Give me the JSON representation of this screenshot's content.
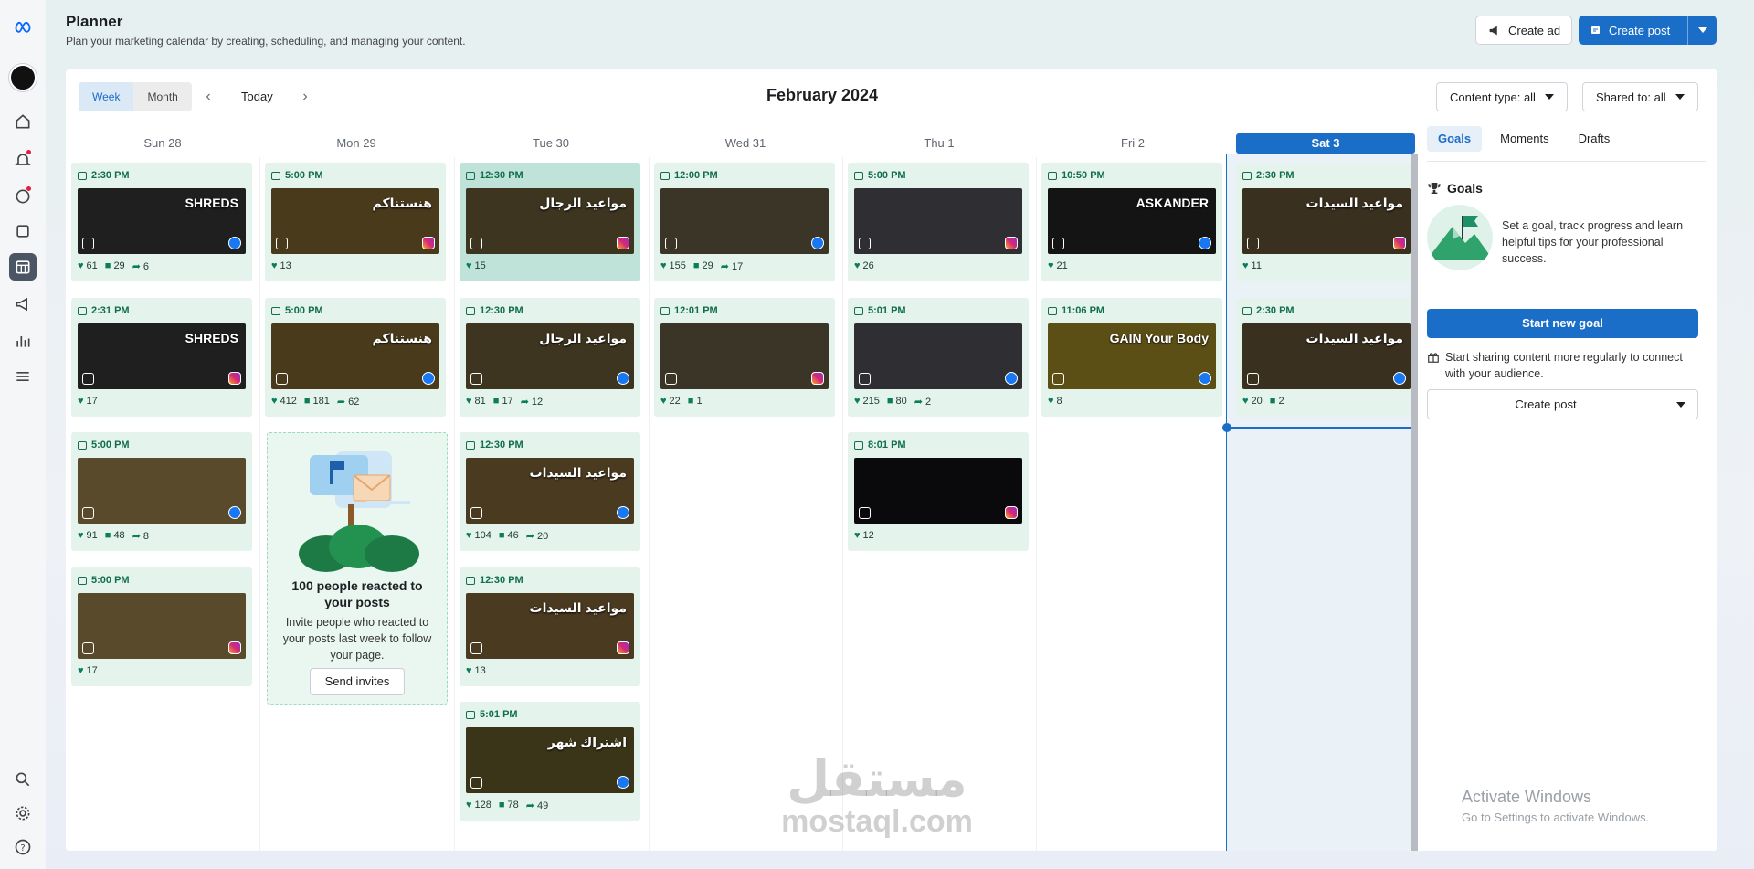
{
  "header": {
    "title": "Planner",
    "subtitle": "Plan your marketing calendar by creating, scheduling, and managing your content.",
    "create_ad": "Create ad",
    "create_post": "Create post"
  },
  "toolbar": {
    "week": "Week",
    "month": "Month",
    "today": "Today",
    "month_title": "February 2024",
    "content_type": "Content type: all",
    "shared_to": "Shared to: all"
  },
  "days": [
    "Sun 28",
    "Mon 29",
    "Tue 30",
    "Wed 31",
    "Thu 1",
    "Fri 2",
    "Sat 3"
  ],
  "columns": [
    [
      {
        "time": "2:30 PM",
        "title": "SHREDS",
        "bg": "#1f1f1f",
        "platform": "fb",
        "likes": "61",
        "comments": "29",
        "shares": "6"
      },
      {
        "time": "2:31 PM",
        "title": "SHREDS",
        "bg": "#1f1f1f",
        "platform": "ig",
        "likes": "17"
      },
      {
        "time": "5:00 PM",
        "title": "",
        "bg": "#5a4a2c",
        "platform": "fb",
        "likes": "91",
        "comments": "48",
        "shares": "8"
      },
      {
        "time": "5:00 PM",
        "title": "",
        "bg": "#5a4a2c",
        "platform": "ig",
        "likes": "17"
      }
    ],
    [
      {
        "time": "5:00 PM",
        "title": "هنستناكم",
        "bg": "#4a3a1c",
        "platform": "ig",
        "likes": "13"
      },
      {
        "time": "5:00 PM",
        "title": "هنستناكم",
        "bg": "#4a3a1c",
        "platform": "fb",
        "likes": "412",
        "comments": "181",
        "shares": "62"
      }
    ],
    [
      {
        "time": "12:30 PM",
        "title": "مواعيد الرجال",
        "bg": "#3d3520",
        "platform": "ig",
        "likes": "15",
        "hl": true
      },
      {
        "time": "12:30 PM",
        "title": "مواعيد الرجال",
        "bg": "#3d3520",
        "platform": "fb",
        "likes": "81",
        "comments": "17",
        "shares": "12"
      },
      {
        "time": "12:30 PM",
        "title": "مواعيد السيدات",
        "bg": "#4a3a20",
        "platform": "fb",
        "likes": "104",
        "comments": "46",
        "shares": "20"
      },
      {
        "time": "12:30 PM",
        "title": "مواعيد السيدات",
        "bg": "#4a3a20",
        "platform": "ig",
        "likes": "13"
      },
      {
        "time": "5:01 PM",
        "title": "اشتراك شهر",
        "bg": "#3a3418",
        "platform": "fb",
        "likes": "128",
        "comments": "78",
        "shares": "49"
      }
    ],
    [
      {
        "time": "12:00 PM",
        "title": "",
        "bg": "#3a3526",
        "platform": "fb",
        "likes": "155",
        "comments": "29",
        "shares": "17"
      },
      {
        "time": "12:01 PM",
        "title": "",
        "bg": "#3a3526",
        "platform": "ig",
        "likes": "22",
        "comments": "1"
      }
    ],
    [
      {
        "time": "5:00 PM",
        "title": "",
        "bg": "#2f2f33",
        "platform": "ig",
        "likes": "26"
      },
      {
        "time": "5:01 PM",
        "title": "",
        "bg": "#2f2f33",
        "platform": "fb",
        "likes": "215",
        "comments": "80",
        "shares": "2"
      },
      {
        "time": "8:01 PM",
        "title": "",
        "bg": "#0a0a0d",
        "platform": "ig",
        "likes": "12"
      }
    ],
    [
      {
        "time": "10:50 PM",
        "title": "ASKANDER",
        "bg": "#141414",
        "platform": "fb",
        "likes": "21"
      },
      {
        "time": "11:06 PM",
        "title": "GAIN Your Body",
        "bg": "#5c4f16",
        "platform": "fb",
        "likes": "8"
      }
    ],
    [
      {
        "time": "2:30 PM",
        "title": "مواعيد السيدات",
        "bg": "#3a3020",
        "platform": "ig",
        "likes": "11"
      },
      {
        "time": "2:30 PM",
        "title": "مواعيد السيدات",
        "bg": "#3a3020",
        "platform": "fb",
        "likes": "20",
        "comments": "2"
      }
    ]
  ],
  "invite": {
    "title": "100 people reacted to your posts",
    "body": "Invite people who reacted to your posts last week to follow your page.",
    "button": "Send invites"
  },
  "sidebar": {
    "tabs": [
      "Goals",
      "Moments",
      "Drafts"
    ],
    "goals_title": "Goals",
    "goals_desc": "Set a goal, track progress and learn helpful tips for your professional success.",
    "start_goal": "Start new goal",
    "tip": "Start sharing content more regularly to connect with your audience.",
    "create_post": "Create post"
  },
  "watermark": {
    "ar": "مستقل",
    "en": "mostaql.com"
  },
  "windows": {
    "line1": "Activate Windows",
    "line2": "Go to Settings to activate Windows."
  },
  "colors": {
    "accent": "#1a6ec7",
    "card": "#e4f3ec",
    "time": "#106e4b"
  }
}
